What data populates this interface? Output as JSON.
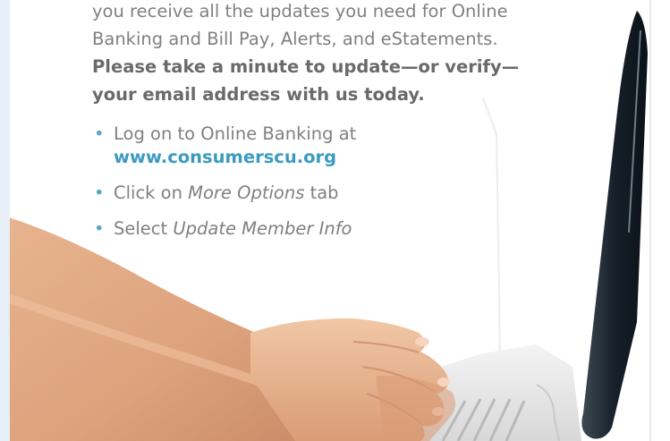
{
  "intro": {
    "line1": "you receive all the updates you need for Online",
    "line2": "Banking and Bill Pay, Alerts, and eStatements."
  },
  "callout": {
    "line1": "Please take a minute to update—or verify—",
    "line2": "your email address with us today."
  },
  "steps": [
    {
      "bullet": "•",
      "prefix": "Log on to Online Banking at",
      "link": "www.consumerscu.org"
    },
    {
      "bullet": "•",
      "prefix": "Click on ",
      "emphasis": "More Options",
      "suffix": " tab"
    },
    {
      "bullet": "•",
      "prefix": "Select ",
      "emphasis": "Update Member Info"
    }
  ],
  "colors": {
    "body_text": "#808080",
    "callout_text": "#6a6a6a",
    "link": "#3b9bbf",
    "bullet": "#5aa6c4",
    "margin_strip": "#e6eff7"
  }
}
